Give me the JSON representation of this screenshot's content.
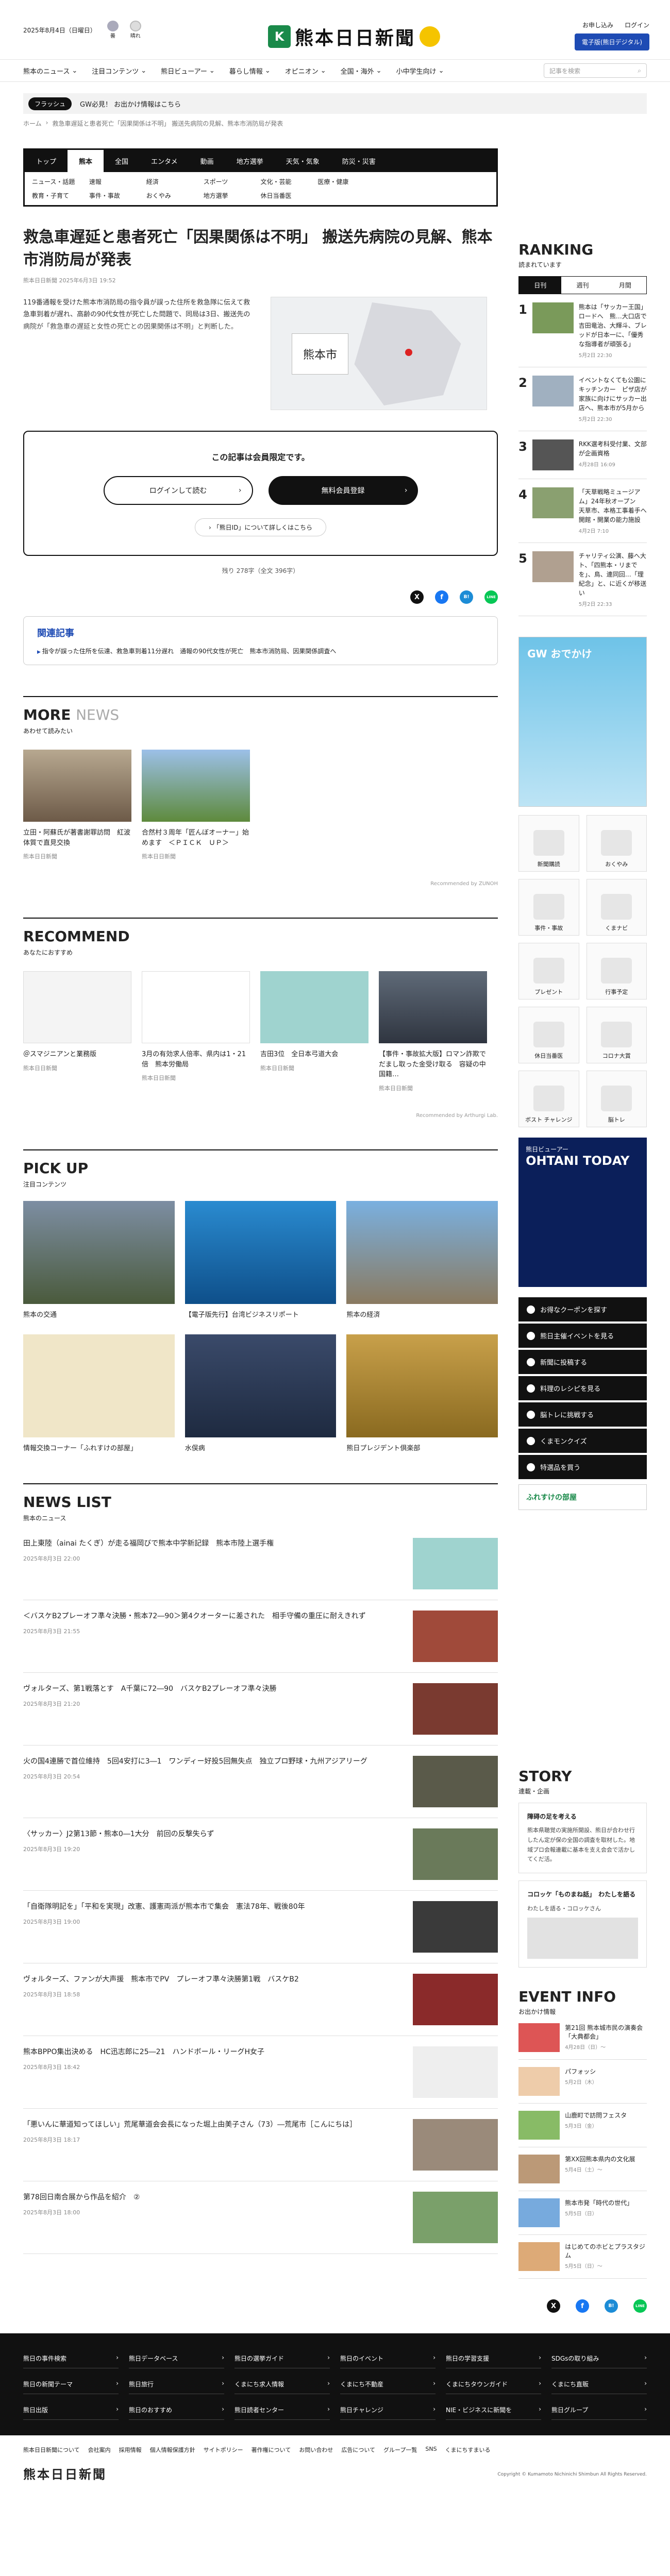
{
  "header": {
    "date": "2025年8月4日（日曜日）",
    "weather": [
      {
        "label": "曇"
      },
      {
        "label": "晴れ"
      }
    ],
    "logo_text": "熊本日日新聞",
    "links": [
      "お申し込み",
      "ログイン"
    ],
    "eshinbun": "電子版(熊日デジタル)"
  },
  "gnav": {
    "items": [
      "熊本のニュース",
      "注目コンテンツ",
      "熊日ビューアー",
      "暮らし情報",
      "オピニオン",
      "全国・海外",
      "小中学生向け"
    ],
    "search_placeholder": "記事を検索"
  },
  "flash": {
    "label": "フラッシュ",
    "text": "GW必見！ お出かけ情報はこちら"
  },
  "breadcrumb": [
    "ホーム",
    "救急車遅延と患者死亡「因果関係は不明」 搬送先病院の見解、熊本市消防局が発表"
  ],
  "categories": {
    "tabs": [
      "トップ",
      "熊本",
      "全国",
      "エンタメ",
      "動画",
      "地方選挙",
      "天気・気象",
      "防災・災害"
    ],
    "active": 1,
    "sub": [
      "ニュース・話題",
      "速報",
      "経済",
      "スポーツ",
      "文化・芸能",
      "医療・健康",
      "教育・子育て",
      "事件・事故",
      "おくやみ",
      "地方選挙",
      "休日当番医"
    ]
  },
  "article": {
    "title": "救急車遅延と患者死亡「因果関係は不明」 搬送先病院の見解、熊本市消防局が発表",
    "meta": "熊本日日新聞 2025年6月3日 19:52",
    "lead": "119番通報を受けた熊本市消防局の指令員が誤った住所を救急隊に伝えて救急車到着が遅れ、高齢の90代女性が死亡した問題で、同局は3日、搬送先の病院が「救急車の遅延と女性の死亡との因果関係は不明」と判断した。",
    "map_label": "熊本市",
    "paywall_title": "この記事は会員限定です。",
    "login_btn": "ログインして読む",
    "register_btn": "無料会員登録",
    "about": "「熊日ID」について詳しくはこちら",
    "char_count": "残り 278字（全文 396字）"
  },
  "share": [
    "X",
    "f",
    "B!",
    "LINE"
  ],
  "related": {
    "title": "関連記事",
    "items": [
      "指令が誤った住所を伝達、救急車到着11分遅れ　通報の90代女性が死亡　熊本市消防局、因果関係調査へ"
    ]
  },
  "more_news": {
    "title_a": "MORE",
    "title_b": "NEWS",
    "sub": "あわせて読みたい",
    "cards": [
      {
        "title": "立田・阿蘇氏が著書謝罪訪問　紅波体質で直見交換",
        "src": "熊本日日新聞"
      },
      {
        "title": "合然村３周年「匠んぼオーナー」始めます　＜ＰＩＣＫ　ＵＰ＞",
        "src": "熊本日日新聞"
      }
    ],
    "powered": "Recommended by ZUNOH"
  },
  "recommend": {
    "title": "RECOMMEND",
    "sub": "あなたにおすすめ",
    "cards": [
      {
        "title": "＠スマジニアンと業務版",
        "src": "熊本日日新聞"
      },
      {
        "title": "3月の有効求人倍率、県内は1・21倍　熊本労働局",
        "src": "熊本日日新聞"
      },
      {
        "title": "吉田3位　全日本弓道大会",
        "src": "熊本日日新聞"
      },
      {
        "title": "【事件・事故拡大版】ロマン詐欺でだまし取った金受け取る　容疑の中国籍…",
        "src": "熊本日日新聞"
      }
    ],
    "powered": "Recommended by Arthurgi Lab."
  },
  "pickup": {
    "title": "PICK UP",
    "sub": "注目コンテンツ",
    "items": [
      "熊本の交通",
      "【電子版先行】台湾ビジネスリポート",
      "熊本の経済",
      "情報交換コーナー「ふれすけの部屋」",
      "水俣病",
      "熊日プレジデント倶楽部"
    ]
  },
  "news_list": {
    "title": "NEWS LIST",
    "sub": "熊本のニュース",
    "items": [
      {
        "hl": "田上東陸（ainai たくぎ）が走る福岡びで熊本中学新記録　熊本市陸上選手権",
        "time": "2025年8月3日 22:00"
      },
      {
        "hl": "＜バスケB2プレーオフ準々決勝・熊本72―90＞第4クオーターに差された　相手守備の重圧に耐えきれず",
        "time": "2025年8月3日 21:55"
      },
      {
        "hl": "ヴォルターズ、第1戦落とす　A千葉に72―90　バスケB2プレーオフ準々決勝",
        "time": "2025年8月3日 21:20"
      },
      {
        "hl": "火の国4連勝で首位維持　5回4安打に3―1　ワンディー好投5回無失点　独立プロ野球・九州アジアリーグ",
        "time": "2025年8月3日 20:54"
      },
      {
        "hl": "〈サッカー〉J2第13節・熊本0―1大分　前回の反撃失らず",
        "time": "2025年8月3日 19:20"
      },
      {
        "hl": "「自衛隊明記を」「平和を実現」改憲、護憲両派が熊本市で集会　憲法78年、戦後80年",
        "time": "2025年8月3日 19:00"
      },
      {
        "hl": "ヴォルターズ、ファンが大声援　熊本市でPV　プレーオフ準々決勝第1戦　バスケB2",
        "time": "2025年8月3日 18:58"
      },
      {
        "hl": "熊本BPPO集出決める　HC迅志郎に25―21　ハンドボール・リーグH女子",
        "time": "2025年8月3日 18:42"
      },
      {
        "hl": "「悪いんに華道知ってほしい」荒尾華道会会長になった堀上由美子さん（73）―荒尾市［こんにちは］",
        "time": "2025年8月3日 18:17"
      },
      {
        "hl": "第78回日南合展から作品を紹介　②",
        "time": "2025年8月3日 18:00"
      }
    ]
  },
  "ranking": {
    "title": "RANKING",
    "sub": "読まれています",
    "tabs": [
      "日刊",
      "週刊",
      "月間"
    ],
    "items": [
      {
        "rank": "1",
        "title": "熊本は「サッカー王国」ロードへ　熊…大口店で吉田竜治、大輝斗、ブレッドが日本一に、「優秀な指導者が頑張る」",
        "date": "5月2日 22:30"
      },
      {
        "rank": "2",
        "title": "イベントなくても公園にキッチンカー　ピザ店が家族に向けにサッカー出店へ、熊本市が5月から",
        "date": "5月2日 22:30"
      },
      {
        "rank": "3",
        "title": "RKK選考科受付業、文部が企画資格",
        "date": "4月28日 16:09"
      },
      {
        "rank": "4",
        "title": "「天草戦略ミュージアム」24年秋オープン　天草市、本格工事着手へ　開館・開業の能力施設",
        "date": "4月2日 7:10"
      },
      {
        "rank": "5",
        "title": "チャリティ公演、藤へ大ト、「四熊本・リまでを」、鳥、連同回…「理紀念」と、に近くが移送い",
        "date": "5月2日 22:33"
      }
    ]
  },
  "sidebar": {
    "ad_title": "GW おでかけ",
    "tiles": [
      "新聞購読",
      "おくやみ",
      "事件・事故",
      "くまナビ",
      "プレゼント",
      "行事予定",
      "休日当番医",
      "コロナ大賞",
      "ボスト チャレンジ",
      "脳トレ"
    ],
    "ohtani": {
      "t1": "熊日ビューアー",
      "t2": "OHTANI TODAY"
    },
    "links": [
      "お得なクーポンを探す",
      "熊日主催イベントを見る",
      "新聞に投稿する",
      "料理のレシピを見る",
      "脳トレに挑戦する",
      "くまモンクイズ",
      "特選品を買う"
    ],
    "fureai": "ふれすけの部屋"
  },
  "story": {
    "title": "STORY",
    "sub": "連載・企画",
    "card_title": "障碍の足を考える",
    "card_text": "熊本県聴覚の実施所開設、熊日が合わせ行したん定が保の全国の調査を取材した。地域プロ会報連載に基本を支え会会で活かしてくだ活。",
    "card2": "コロッケ「ものまね話」　わたしを語る",
    "card2_sub": "わたしを語る・コロッケさん"
  },
  "event": {
    "title": "EVENT INFO",
    "sub": "お出かけ情報",
    "items": [
      {
        "title": "第21回 熊本城市民の演奏会「大典都会」",
        "date": "4月28日（日）〜"
      },
      {
        "title": "パフォッシ",
        "date": "5月2日（木）"
      },
      {
        "title": "山鹿町で訪問フェスタ",
        "date": "5月3日（金）"
      },
      {
        "title": "第XX回熊本県内の文化展",
        "date": "5月4日（土）〜"
      },
      {
        "title": "熊本市発「時代の世代」",
        "date": "5月5日（日）"
      },
      {
        "title": "はじめてのホビとプラスタジム",
        "date": "5月5日（日）〜"
      }
    ]
  },
  "footer": {
    "links": [
      "熊日の事件検索",
      "熊日データベース",
      "熊日の選挙ガイド",
      "熊日のイベント",
      "熊日の学習支援",
      "SDGsの取り組み",
      "熊日の新聞テーマ",
      "熊日旅行",
      "くまにち求人情報",
      "くまにち不動産",
      "くまにちタウンガイド",
      "くまにち直販",
      "熊日出版",
      "熊日のおすすめ",
      "熊日読者センター",
      "熊日チャレンジ",
      "NIE・ビジネスに新聞を",
      "熊日グループ"
    ],
    "bottom_links": [
      "熊本日日新聞について",
      "会社案内",
      "採用情報",
      "個人情報保護方針",
      "サイトポリシー",
      "著作権について",
      "お問い合わせ",
      "広告について",
      "グループ一覧",
      "SNS",
      "くまにちすまいる"
    ],
    "logo": "熊本日日新聞",
    "copyright": "Copyright © Kumamoto Nichinichi Shimbun All Rights Reserved."
  },
  "colors": {
    "accent": "#1e4bb4",
    "green": "#1a8a4a",
    "dark": "#111111"
  }
}
